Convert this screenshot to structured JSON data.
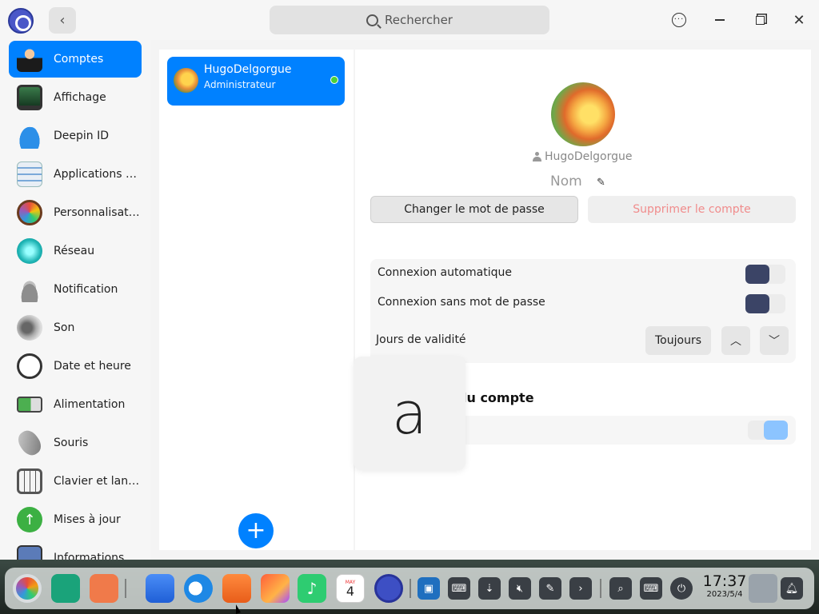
{
  "titlebar": {
    "search_placeholder": "Rechercher",
    "menu_icon": "ellipsis-circle-icon",
    "min_icon": "minimize-icon",
    "max_icon": "restore-icon",
    "close_icon": "close-icon"
  },
  "sidebar": {
    "items": [
      {
        "label": "Comptes",
        "icon": "accounts-icon"
      },
      {
        "label": "Affichage",
        "icon": "display-icon"
      },
      {
        "label": "Deepin ID",
        "icon": "cloud-icon"
      },
      {
        "label": "Applications p...",
        "icon": "default-apps-icon"
      },
      {
        "label": "Personnalisati...",
        "icon": "palette-icon"
      },
      {
        "label": "Réseau",
        "icon": "network-icon"
      },
      {
        "label": "Notification",
        "icon": "bell-icon"
      },
      {
        "label": "Son",
        "icon": "speaker-icon"
      },
      {
        "label": "Date et heure",
        "icon": "clock-icon"
      },
      {
        "label": "Alimentation",
        "icon": "battery-icon"
      },
      {
        "label": "Souris",
        "icon": "mouse-icon"
      },
      {
        "label": "Clavier et lang...",
        "icon": "keyboard-icon"
      },
      {
        "label": "Mises à jour",
        "icon": "update-arrow-icon"
      },
      {
        "label": "Informations",
        "icon": "info-icon"
      }
    ]
  },
  "accounts": {
    "user": {
      "name": "HugoDelgorgue",
      "role": "Administrateur",
      "status": "online"
    }
  },
  "detail": {
    "username": "HugoDelgorgue",
    "name_placeholder": "Nom",
    "change_password": "Changer le mot de passe",
    "delete_account": "Supprimer le compte",
    "auto_login": "Connexion automatique",
    "auto_login_on": false,
    "no_password_login": "Connexion sans mot de passe",
    "no_password_login_on": false,
    "validity_label": "Jours de validité",
    "validity_value": "Toujours",
    "section_title_visible": "lu compte",
    "section_toggle_on": true
  },
  "overlay": {
    "glyph": "a"
  },
  "dock": {
    "clock_time": "17:37",
    "clock_date": "2023/5/4",
    "calendar_day": "4",
    "calendar_month": "MAY"
  },
  "colors": {
    "accent": "#0081ff",
    "toggle_knob": "#3b4466",
    "delete_text": "#f08c8c",
    "online": "#4cd137"
  }
}
